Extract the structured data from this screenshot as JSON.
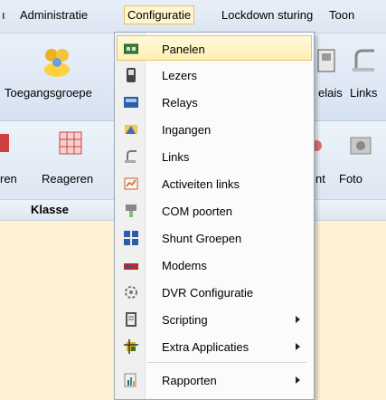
{
  "menubar": {
    "items": [
      "Administratie",
      "Configuratie",
      "Lockdown sturing",
      "Toon"
    ],
    "active": "Configuratie"
  },
  "ribbon": {
    "left_label": "Toegangsgroepe",
    "right_labels": [
      "elais",
      "Links"
    ],
    "row2_left": [
      "ren",
      "Reageren"
    ],
    "row2_right": [
      "nt",
      "Foto"
    ]
  },
  "table": {
    "column_header": "Klasse"
  },
  "dropdown": {
    "items": [
      {
        "label": "Panelen",
        "icon": "panel-icon"
      },
      {
        "label": "Lezers",
        "icon": "reader-icon"
      },
      {
        "label": "Relays",
        "icon": "relay-icon"
      },
      {
        "label": "Ingangen",
        "icon": "input-icon"
      },
      {
        "label": "Links",
        "icon": "link-icon"
      },
      {
        "label": "Activeiten links",
        "icon": "activity-links-icon"
      },
      {
        "label": "COM poorten",
        "icon": "com-port-icon"
      },
      {
        "label": "Shunt Groepen",
        "icon": "shunt-groups-icon"
      },
      {
        "label": "Modems",
        "icon": "modem-icon"
      },
      {
        "label": "DVR Configuratie",
        "icon": "dvr-icon"
      },
      {
        "label": "Scripting",
        "icon": "script-icon",
        "submenu": true
      },
      {
        "label": "Extra Applicaties",
        "icon": "extra-apps-icon",
        "submenu": true
      },
      {
        "label": "Rapporten",
        "icon": "reports-icon",
        "submenu": true
      }
    ]
  },
  "colors": {
    "background": "#fdf2d2",
    "hover": "#ffefb3"
  }
}
